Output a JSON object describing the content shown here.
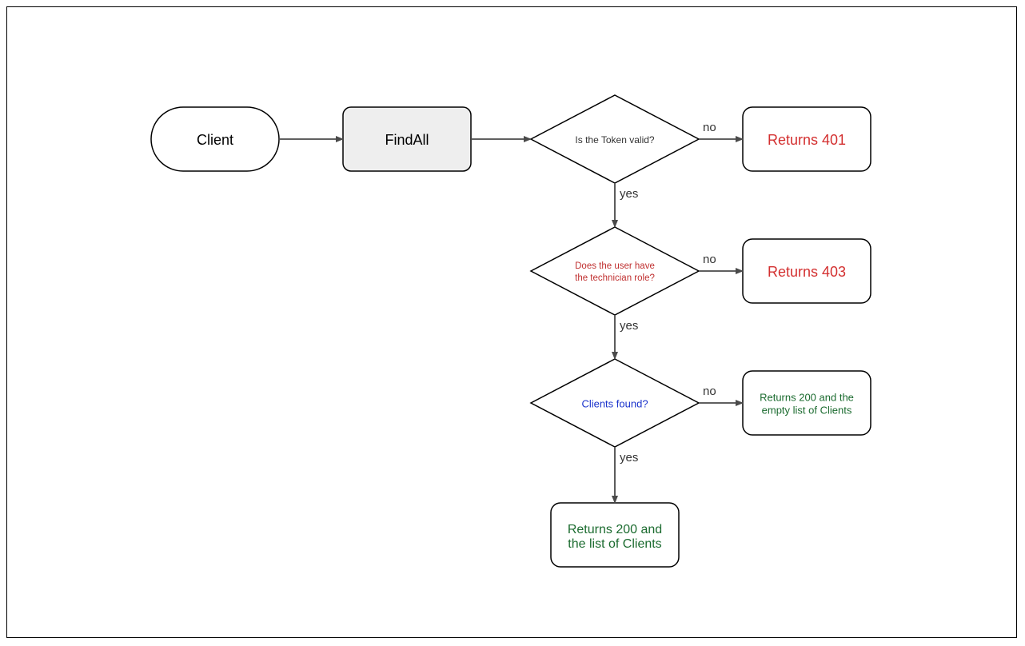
{
  "nodes": {
    "start": {
      "label": "Client"
    },
    "findall": {
      "label": "FindAll"
    },
    "token": {
      "label": "Is the Token valid?"
    },
    "role": {
      "line1": "Does the user have",
      "line2": "the technician role?"
    },
    "found": {
      "label": "Clients found?"
    },
    "r401": {
      "label": "Returns 401"
    },
    "r403": {
      "label": "Returns 403"
    },
    "r200empty": {
      "line1": "Returns 200 and the",
      "line2": "empty list of Clients"
    },
    "r200list": {
      "line1": "Returns 200 and",
      "line2": "the list of Clients"
    }
  },
  "edges": {
    "no": "no",
    "yes": "yes"
  },
  "colors": {
    "error": "#d32f2f",
    "success": "#1b6b2f",
    "query": "#1a33cc",
    "shapeStroke": "#000000",
    "arrow": "#4a4a4a",
    "process_fill": "#eeeeee"
  }
}
